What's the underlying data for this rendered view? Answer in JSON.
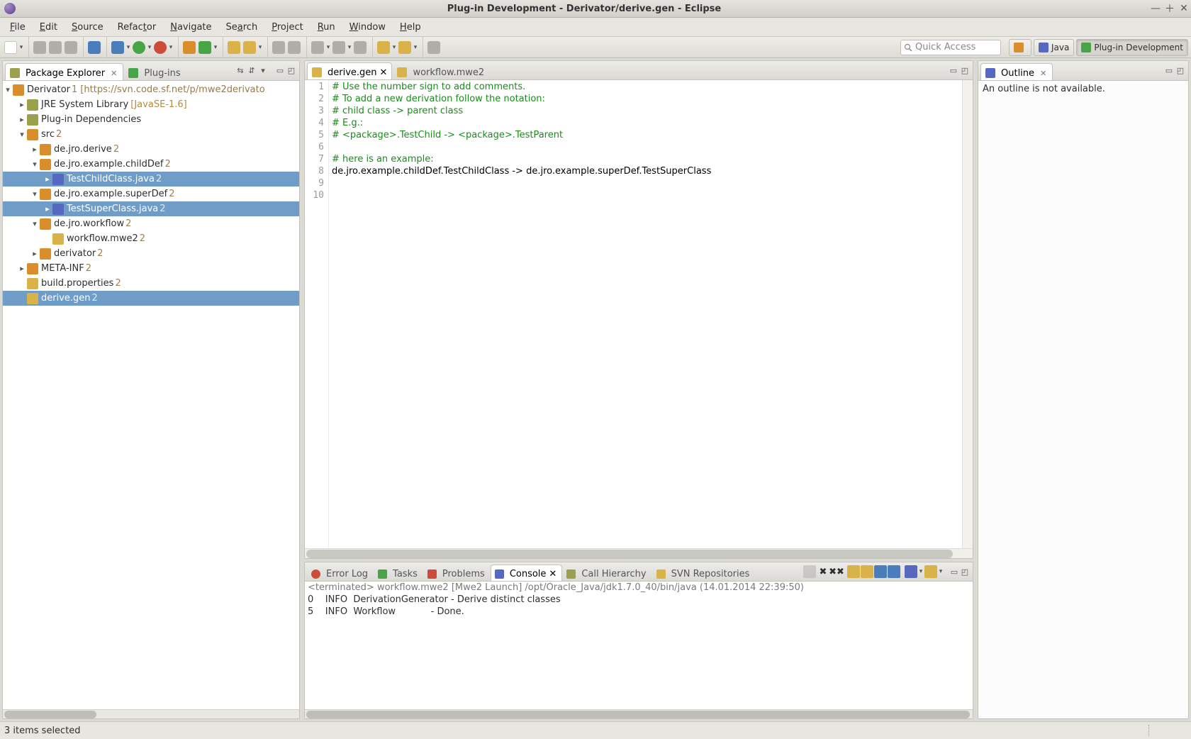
{
  "window": {
    "title": "Plug-in Development - Derivator/derive.gen - Eclipse"
  },
  "menu": {
    "file": "File",
    "edit": "Edit",
    "source": "Source",
    "refactor": "Refactor",
    "navigate": "Navigate",
    "search": "Search",
    "project": "Project",
    "run": "Run",
    "window": "Window",
    "help": "Help"
  },
  "quick_access": {
    "placeholder": "Quick Access"
  },
  "perspectives": {
    "java": "Java",
    "pde": "Plug-in Development"
  },
  "package_explorer": {
    "tab": "Package Explorer",
    "plugins_tab": "Plug-ins",
    "project": "Derivator",
    "project_rev": "1",
    "project_url": "[https://svn.code.sf.net/p/mwe2derivato",
    "jre": "JRE System Library",
    "jre_env": "[JavaSE-1.6]",
    "deps": "Plug-in Dependencies",
    "src": "src",
    "src_rev": "2",
    "pkg_derive": "de.jro.derive",
    "pkg_derive_rev": "2",
    "pkg_child": "de.jro.example.childDef",
    "pkg_child_rev": "2",
    "file_child": "TestChildClass.java",
    "file_child_rev": "2",
    "pkg_super": "de.jro.example.superDef",
    "pkg_super_rev": "2",
    "file_super": "TestSuperClass.java",
    "file_super_rev": "2",
    "pkg_wf": "de.jro.workflow",
    "pkg_wf_rev": "2",
    "file_wf": "workflow.mwe2",
    "file_wf_rev": "2",
    "folder_der": "derivator",
    "folder_der_rev": "2",
    "meta": "META-INF",
    "meta_rev": "2",
    "buildprops": "build.properties",
    "buildprops_rev": "2",
    "derivegen": "derive.gen",
    "derivegen_rev": "2"
  },
  "editor": {
    "tab1": "derive.gen",
    "tab2": "workflow.mwe2",
    "lines": [
      "# Use the number sign to add comments.",
      "# To add a new derivation follow the notation:",
      "# child class -> parent class",
      "# E.g.:",
      "# <package>.TestChild -> <package>.TestParent",
      "",
      "# here is an example:",
      "de.jro.example.childDef.TestChildClass -> de.jro.example.superDef.TestSuperClass",
      "",
      ""
    ]
  },
  "outline": {
    "tab": "Outline",
    "empty": "An outline is not available."
  },
  "bottom_tabs": {
    "errorlog": "Error Log",
    "tasks": "Tasks",
    "problems": "Problems",
    "console": "Console",
    "callhier": "Call Hierarchy",
    "svn": "SVN Repositories"
  },
  "console": {
    "launch": "<terminated> workflow.mwe2 [Mwe2 Launch] /opt/Oracle_Java/jdk1.7.0_40/bin/java (14.01.2014 22:39:50)",
    "l1": "0    INFO  DerivationGenerator - Derive distinct classes",
    "l2": "5    INFO  Workflow            - Done."
  },
  "status": {
    "text": "3 items selected"
  }
}
